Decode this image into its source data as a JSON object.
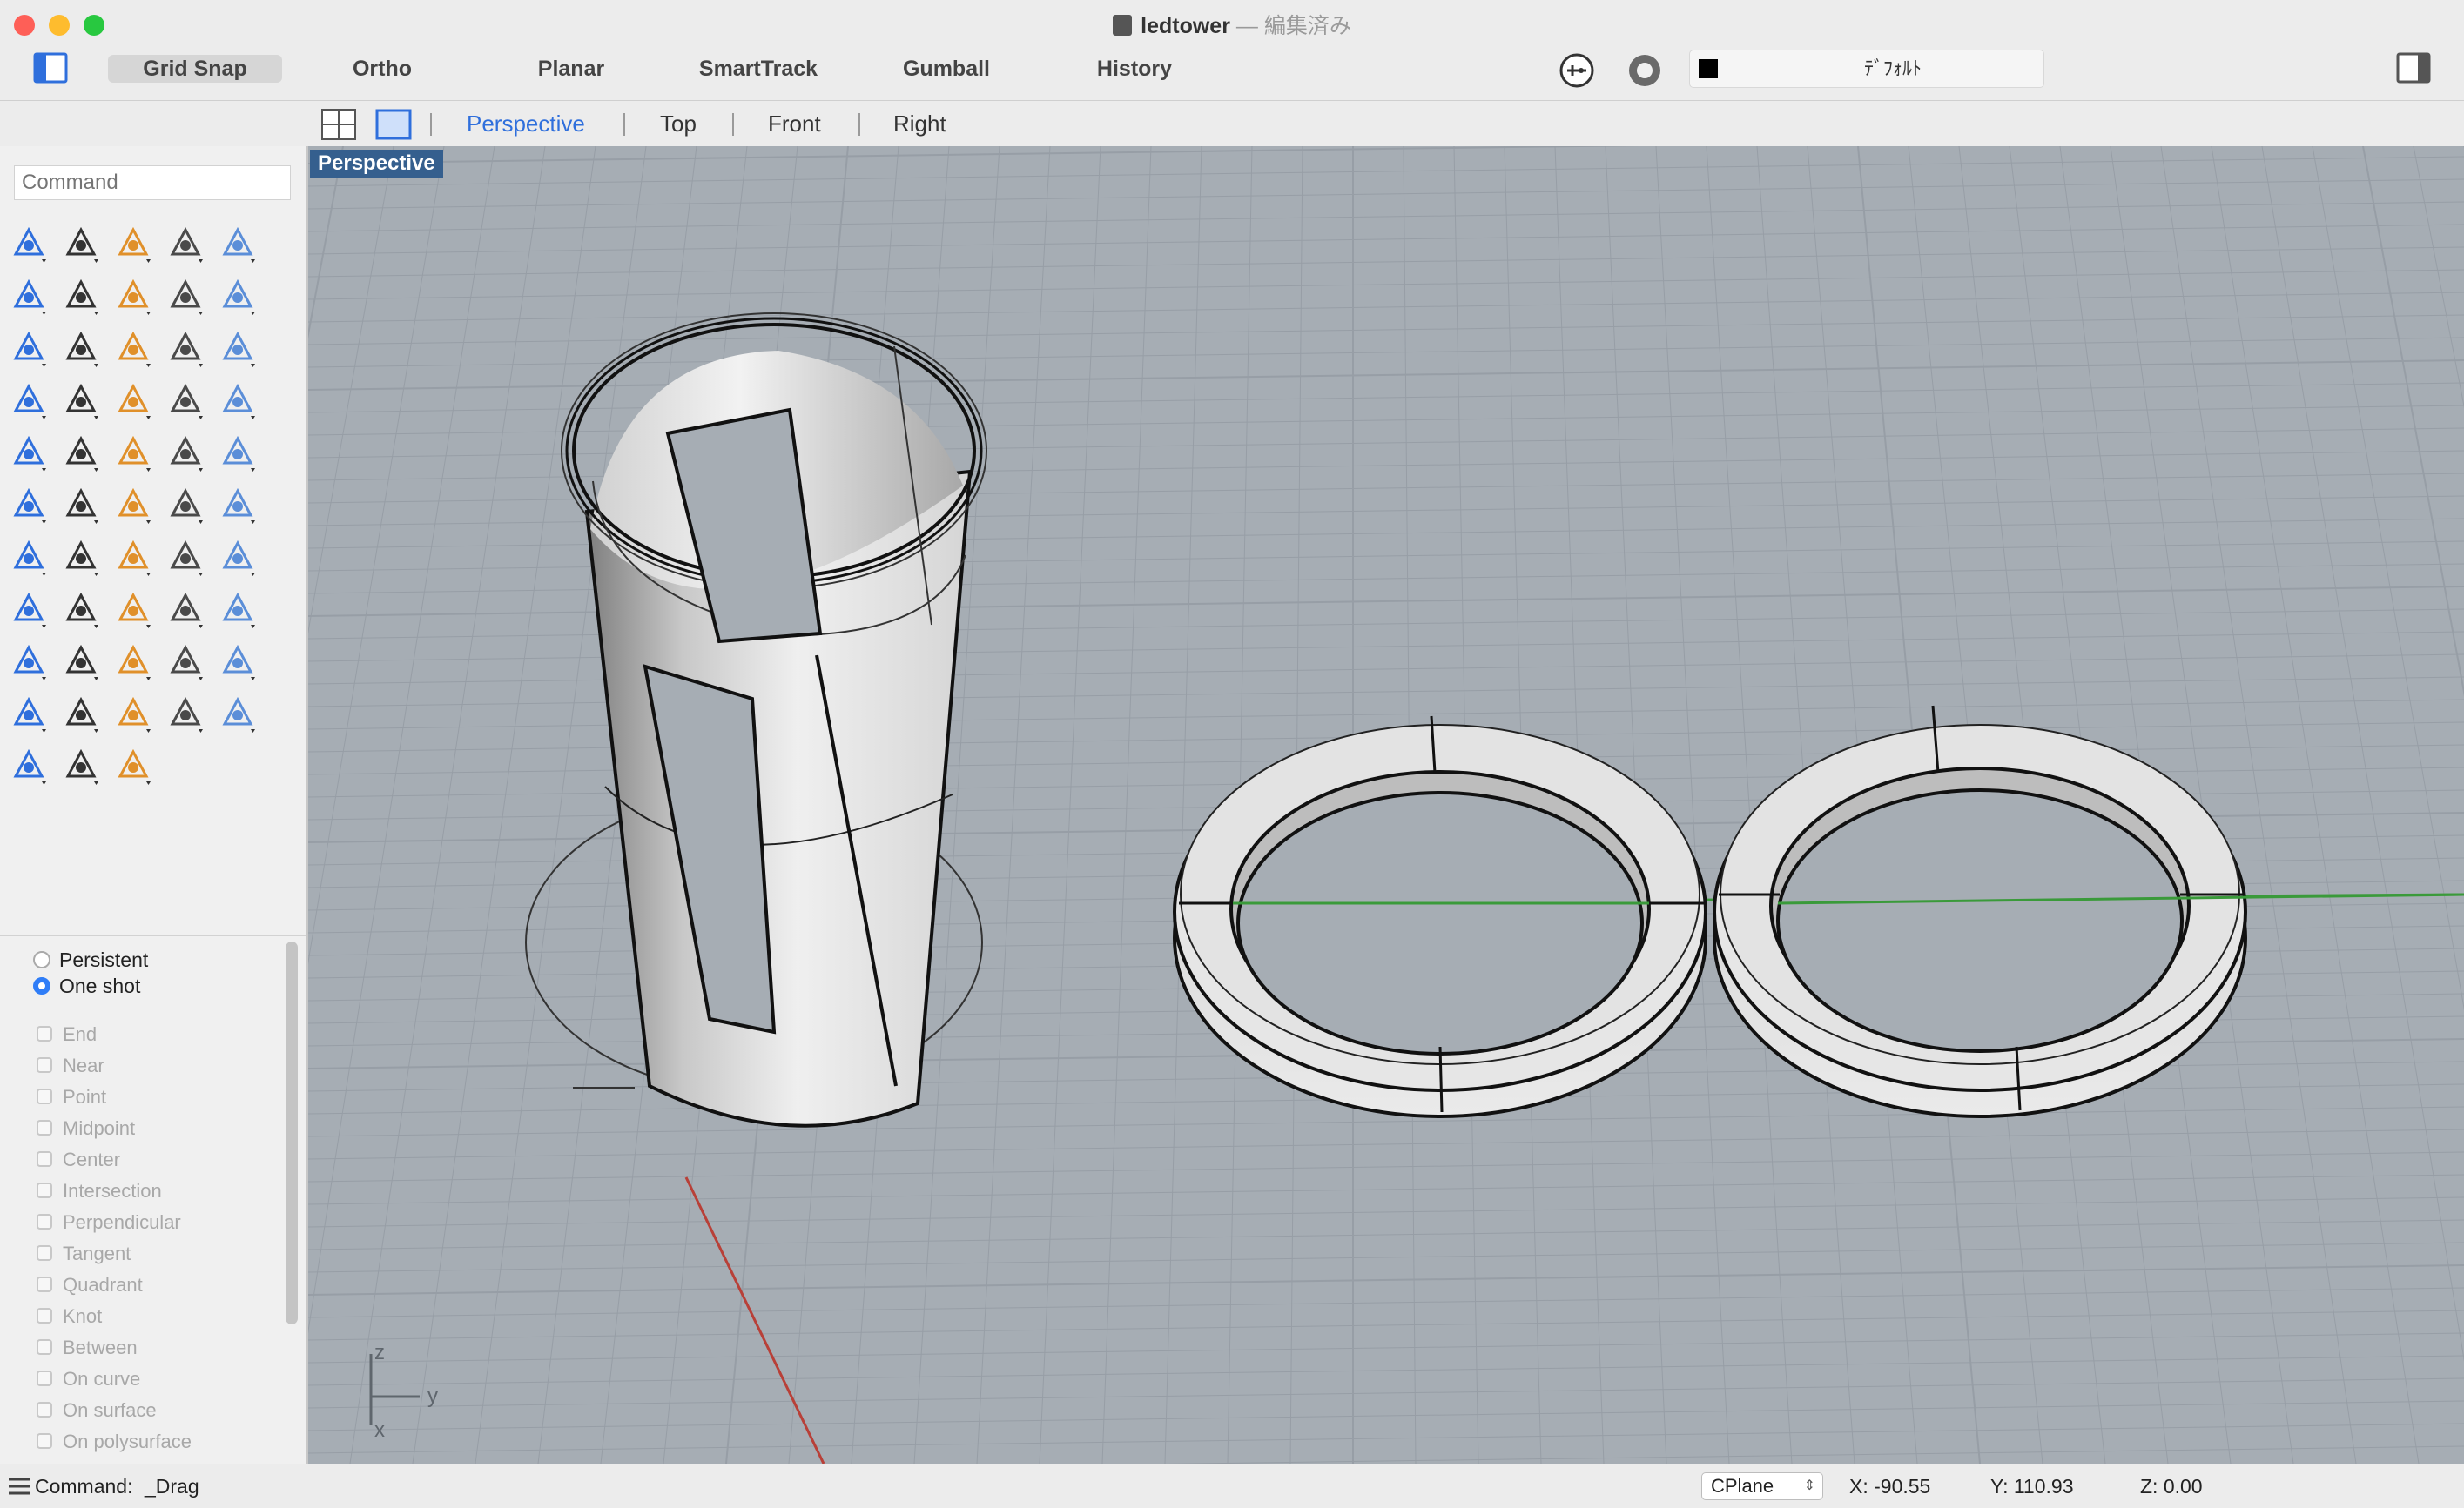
{
  "window": {
    "title": "ledtower",
    "title_separator": "—",
    "edit_state": "編集済み",
    "traffic_lights": {
      "close": "#fe5f57",
      "minimize": "#febc2e",
      "zoom": "#28c840"
    }
  },
  "toolbar": {
    "sidebar_toggle_icon": "sidebar-left-icon",
    "buttons": [
      {
        "label": "Grid Snap",
        "active": true
      },
      {
        "label": "Ortho",
        "active": false
      },
      {
        "label": "Planar",
        "active": false
      },
      {
        "label": "SmartTrack",
        "active": false
      },
      {
        "label": "Gumball",
        "active": false
      },
      {
        "label": "History",
        "active": false
      }
    ],
    "filter_icon": "osnap-filter-icon",
    "render_icon": "material-circle-icon",
    "layer": {
      "swatch_color": "#000000",
      "name": "ﾃﾞﾌｫﾙﾄ"
    },
    "right_panel_icon": "sidebar-right-icon"
  },
  "viewport_tabs": {
    "layout_icons": [
      "four-viewports-icon",
      "single-viewport-icon"
    ],
    "tabs": [
      {
        "label": "Perspective",
        "active": true
      },
      {
        "label": "Top",
        "active": false
      },
      {
        "label": "Front",
        "active": false
      },
      {
        "label": "Right",
        "active": false
      }
    ],
    "active_color": "#2f6fdc"
  },
  "command": {
    "placeholder": "Command"
  },
  "tools": [
    "select-arrow-icon",
    "point-icon",
    "polyline-icon",
    "curve-icon",
    "circle-icon",
    "ellipse-icon",
    "arc-icon",
    "rectangle-icon",
    "polygon-icon",
    "fillet-curve-icon",
    "surface-icon",
    "extrude-surface-icon",
    "box-icon",
    "sphere-icon",
    "cylinder-icon",
    "mesh-icon",
    "patch-icon",
    "boolean-icon",
    "trim-icon",
    "split-icon",
    "group-icon",
    "layers-icon",
    "offset-icon",
    "fillet-icon",
    "text-icon",
    "move-icon",
    "array-icon",
    "transform-icon",
    "box-edit-icon",
    "dimension-icon",
    "grid-array-icon",
    "align-icon",
    "analyze-icon",
    "check-icon",
    "block-icon",
    "zoom-window-icon",
    "zoom-in-icon",
    "zoom-selected-icon",
    "zoom-extents-icon",
    "zoom-icon",
    "rotate-view-icon",
    "car-icon",
    "plane-icon",
    "named-view-icon",
    "light-bulb-icon",
    "lock-icon",
    "material-icon",
    "color-wheel-icon",
    "shaded-sphere-icon",
    "wireframe-sphere-icon",
    "render-sphere-icon",
    "camera-icon",
    "hierarchy-icon"
  ],
  "osnap": {
    "modes": [
      {
        "label": "Persistent",
        "selected": false
      },
      {
        "label": "One shot",
        "selected": true
      }
    ],
    "snaps": [
      "End",
      "Near",
      "Point",
      "Midpoint",
      "Center",
      "Intersection",
      "Perpendicular",
      "Tangent",
      "Quadrant",
      "Knot",
      "Between",
      "On curve",
      "On surface",
      "On polysurface"
    ]
  },
  "viewport": {
    "label": "Perspective",
    "background": "#a6adb4",
    "grid_color": "#979ea6",
    "x_axis_color": "#b84038",
    "y_axis_color": "#3a9a3a",
    "axis_labels": {
      "z": "z",
      "y": "y",
      "x": "x"
    }
  },
  "status": {
    "command_label": "Command:",
    "command_value": "_Drag",
    "cplane": "CPlane",
    "x": "X: -90.55",
    "y": "Y: 110.93",
    "z": "Z: 0.00"
  }
}
